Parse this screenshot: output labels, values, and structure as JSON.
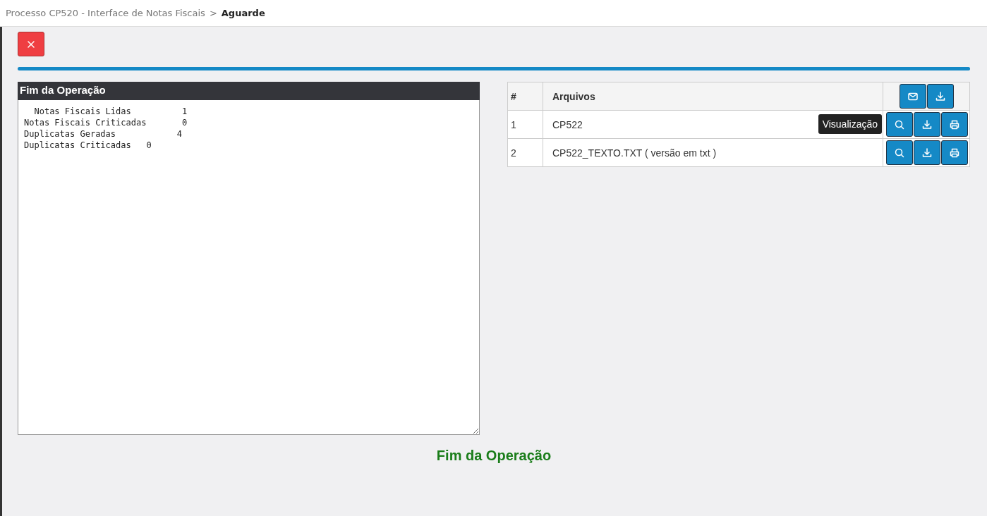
{
  "breadcrumb": {
    "path": "Processo CP520 - Interface de Notas Fiscais",
    "separator": ">",
    "current": "Aguarde"
  },
  "progress": {
    "level": 1
  },
  "log_panel": {
    "title": "Fim da Operação",
    "lines": [
      "  Notas Fiscais Lidas          1",
      "Notas Fiscais Criticadas       0",
      "Duplicatas Geradas            4",
      "Duplicatas Criticadas   0"
    ]
  },
  "files_table": {
    "columns": [
      "#",
      "Arquivos"
    ],
    "rows": [
      {
        "number": "1",
        "file": "CP522",
        "tooltip": "Visualização"
      },
      {
        "number": "2",
        "file": "CP522_TEXTO.TXT ( versão em txt )"
      }
    ]
  },
  "status_message": "Fim da Operação"
}
